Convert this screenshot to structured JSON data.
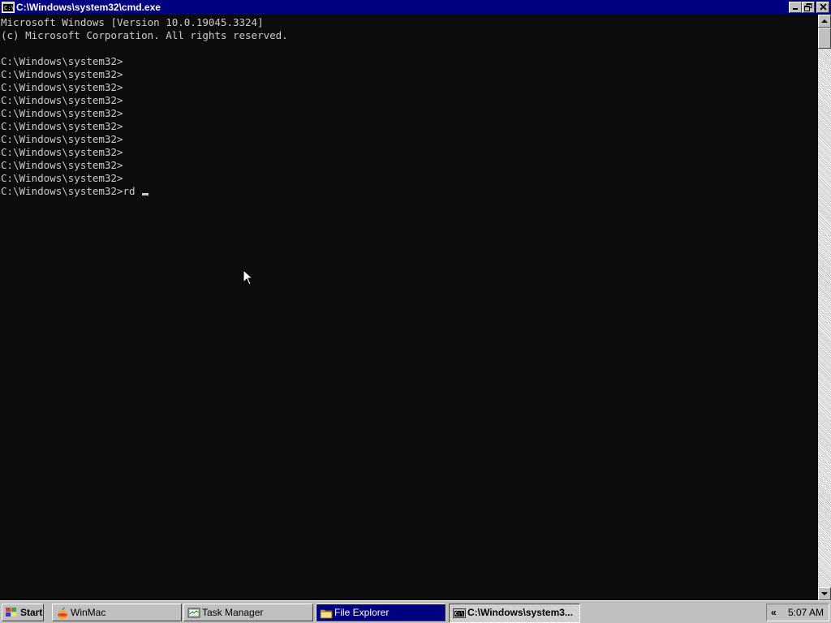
{
  "window": {
    "title": "C:\\Windows\\system32\\cmd.exe",
    "icon": "cmd-window-icon",
    "controls": {
      "minimize": "minimize-icon",
      "restore": "restore-icon",
      "close": "close-icon"
    }
  },
  "console": {
    "lines": [
      "Microsoft Windows [Version 10.0.19045.3324]",
      "(c) Microsoft Corporation. All rights reserved.",
      "",
      "C:\\Windows\\system32>",
      "C:\\Windows\\system32>",
      "C:\\Windows\\system32>",
      "C:\\Windows\\system32>",
      "C:\\Windows\\system32>",
      "C:\\Windows\\system32>",
      "C:\\Windows\\system32>",
      "C:\\Windows\\system32>",
      "C:\\Windows\\system32>",
      "C:\\Windows\\system32>"
    ],
    "current_prompt": "C:\\Windows\\system32>",
    "current_input": "rd ",
    "background": "#0c0c0c",
    "foreground": "#cccccc"
  },
  "taskbar": {
    "start_label": "Start",
    "tasks": [
      {
        "label": "WinMac",
        "icon": "apple-icon"
      },
      {
        "label": "Task Manager",
        "icon": "task-manager-icon"
      },
      {
        "label": "File Explorer",
        "icon": "folder-icon"
      },
      {
        "label": "C:\\Windows\\system3...",
        "icon": "cmd-icon"
      }
    ],
    "tray": {
      "chevron": "«",
      "clock": "5:07 AM"
    }
  },
  "colors": {
    "titlebar": "#000080",
    "chrome": "#c0c0c0",
    "active_task": "#000080"
  }
}
